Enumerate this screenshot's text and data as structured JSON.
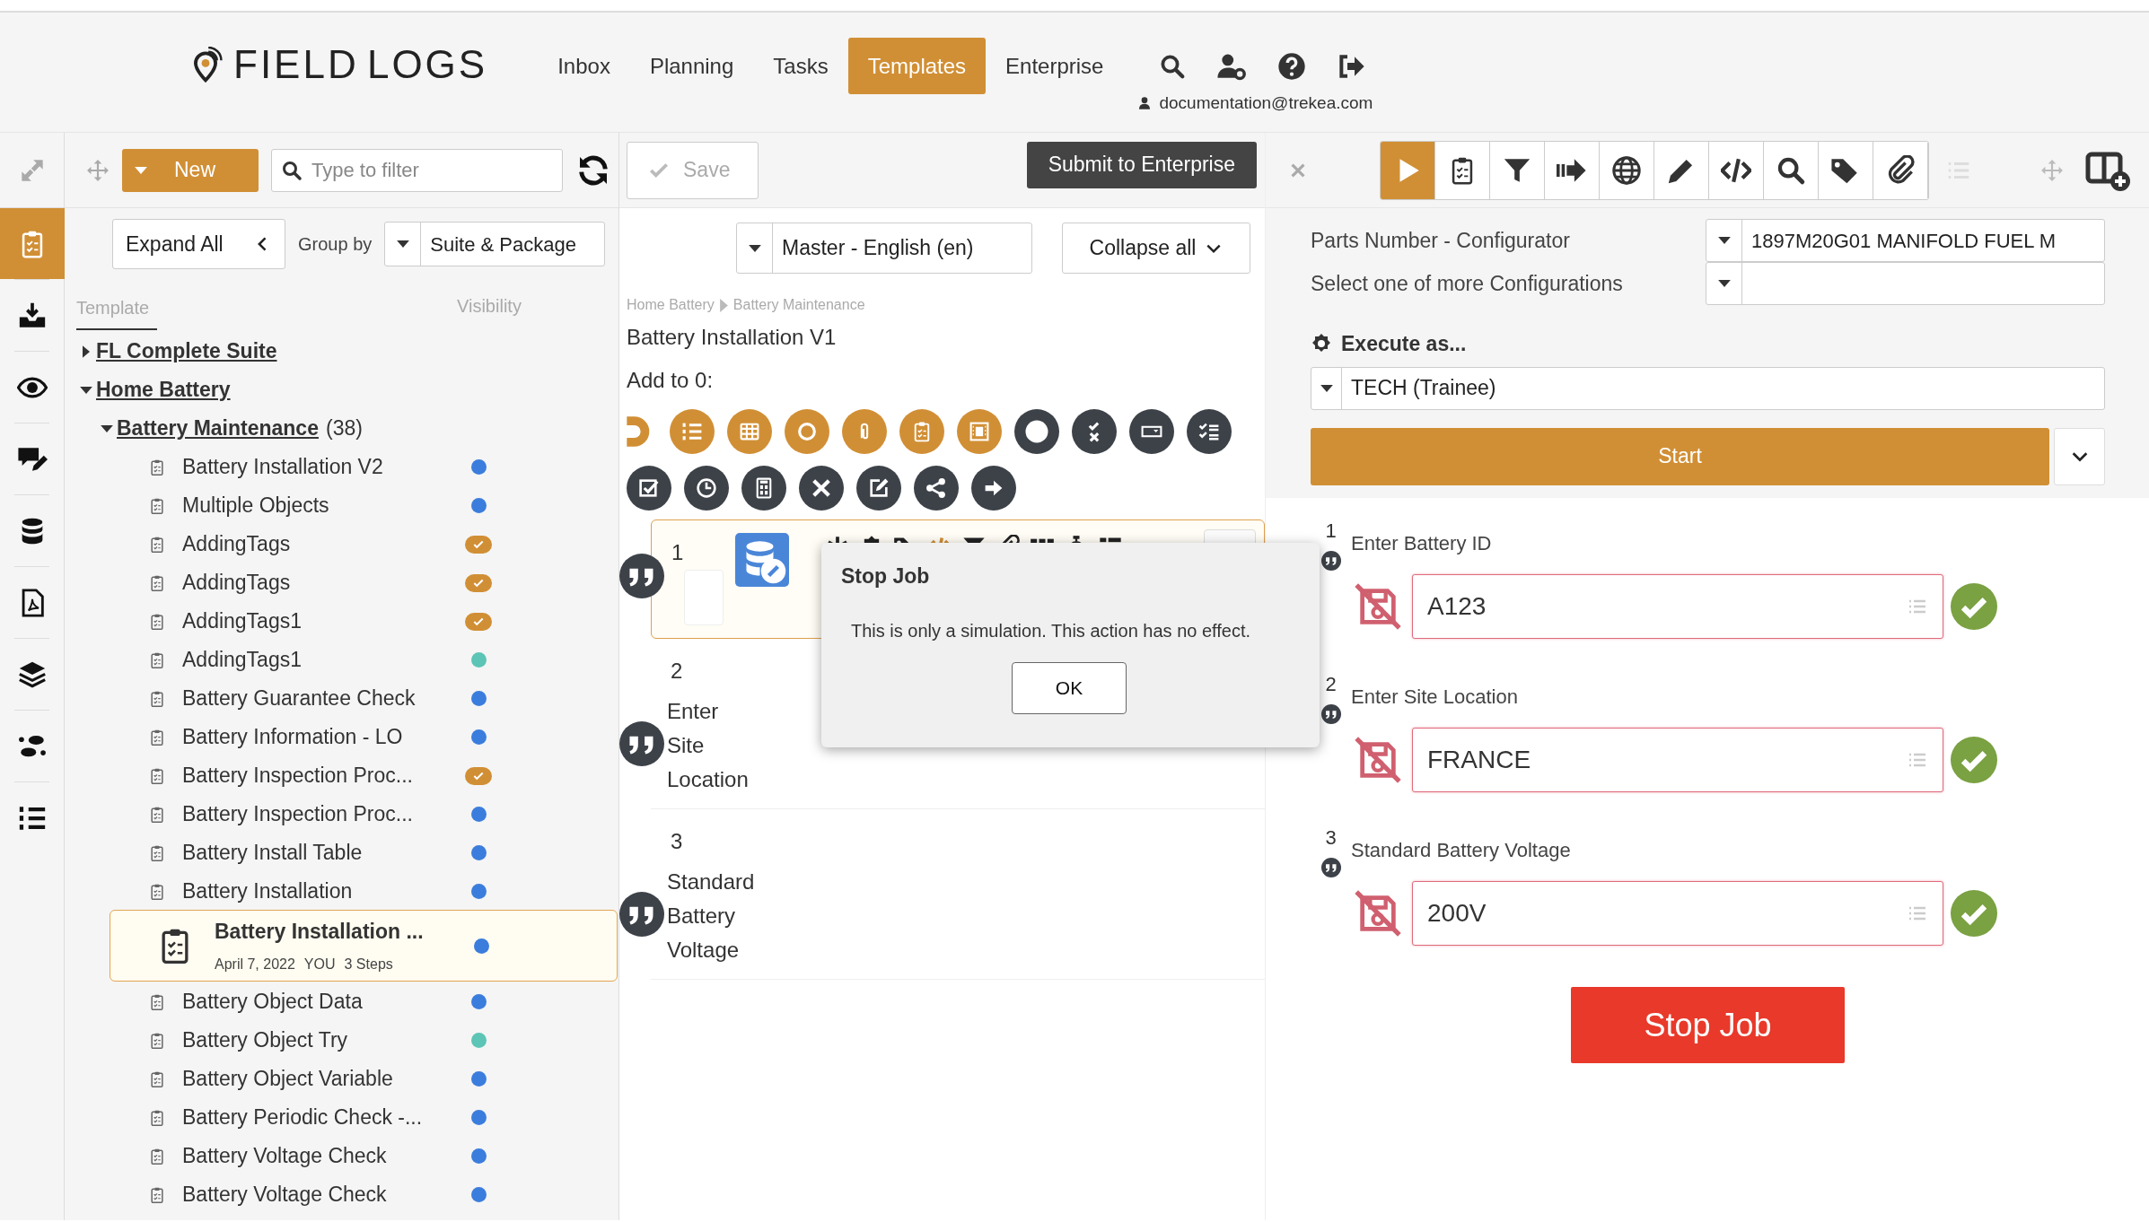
{
  "header": {
    "logo": "FIELD LOGS",
    "nav": [
      {
        "label": "Inbox",
        "selected": false
      },
      {
        "label": "Planning",
        "selected": false
      },
      {
        "label": "Tasks",
        "selected": false
      },
      {
        "label": "Templates",
        "selected": true
      },
      {
        "label": "Enterprise",
        "selected": false
      }
    ],
    "user_email": "documentation@trekea.com"
  },
  "rail": [
    {
      "selected": true
    },
    {
      "selected": false
    },
    {
      "selected": false
    },
    {
      "selected": false
    },
    {
      "selected": false
    },
    {
      "selected": false
    },
    {
      "selected": false
    },
    {
      "selected": false
    },
    {
      "selected": false
    }
  ],
  "left_panel": {
    "new_button": "New",
    "filter_placeholder": "Type to filter",
    "expand_button": "Expand All",
    "group_by_label": "Group by",
    "group_by_value": "Suite & Package",
    "columns": [
      "Template",
      "Visibility"
    ],
    "tree": [
      {
        "label": "FL Complete Suite",
        "expanded": false
      },
      {
        "label": "Home Battery",
        "expanded": true,
        "children": [
          {
            "label": "Battery Maintenance",
            "count": "(38)",
            "expanded": true,
            "children": [
              {
                "label": "Battery Installation V2",
                "kind": "dot",
                "color": "#3b7ddd",
                "selected": false
              },
              {
                "label": "Multiple Objects",
                "kind": "dot",
                "color": "#3b7ddd",
                "selected": false
              },
              {
                "label": "AddingTags",
                "kind": "check",
                "color": "#d18f35",
                "selected": false
              },
              {
                "label": "AddingTags",
                "kind": "check",
                "color": "#d18f35",
                "selected": false
              },
              {
                "label": "AddingTags1",
                "kind": "check",
                "color": "#d18f35",
                "selected": false
              },
              {
                "label": "AddingTags1",
                "kind": "dot",
                "color": "#5cc5b5",
                "selected": false
              },
              {
                "label": "Battery Guarantee Check",
                "kind": "dot",
                "color": "#3b7ddd",
                "selected": false
              },
              {
                "label": "Battery Information - LO",
                "kind": "dot",
                "color": "#3b7ddd",
                "selected": false
              },
              {
                "label": "Battery Inspection Proc...",
                "kind": "check",
                "color": "#d18f35",
                "selected": false
              },
              {
                "label": "Battery Inspection Proc...",
                "kind": "dot",
                "color": "#3b7ddd",
                "selected": false
              },
              {
                "label": "Battery Install Table",
                "kind": "dot",
                "color": "#3b7ddd",
                "selected": false
              },
              {
                "label": "Battery Installation",
                "kind": "dot",
                "color": "#3b7ddd",
                "selected": false
              },
              {
                "label": "Battery Installation ...",
                "kind": "dot",
                "color": "#3b7ddd",
                "selected": true,
                "date": "April 7, 2022",
                "author": "YOU",
                "steps": "3 Steps"
              },
              {
                "label": "Battery Object Data",
                "kind": "dot",
                "color": "#3b7ddd",
                "selected": false
              },
              {
                "label": "Battery Object Try",
                "kind": "dot",
                "color": "#5cc5b5",
                "selected": false
              },
              {
                "label": "Battery Object Variable",
                "kind": "dot",
                "color": "#3b7ddd",
                "selected": false
              },
              {
                "label": "Battery Periodic Check -...",
                "kind": "dot",
                "color": "#3b7ddd",
                "selected": false
              },
              {
                "label": "Battery Voltage Check",
                "kind": "dot",
                "color": "#3b7ddd",
                "selected": false
              },
              {
                "label": "Battery Voltage Check",
                "kind": "dot",
                "color": "#3b7ddd",
                "selected": false
              }
            ]
          }
        ]
      }
    ]
  },
  "middle": {
    "save_button": "Save",
    "submit_button": "Submit to Enterprise",
    "language": "Master - English (en)",
    "collapse_button": "Collapse all",
    "breadcrumb": [
      "Home Battery",
      "Battery Maintenance"
    ],
    "title": "Battery Installation V1",
    "add_label": "Add to 0:",
    "steps": [
      {
        "number": "1",
        "selected": true
      },
      {
        "number": "2",
        "label": "Enter Site Location",
        "selected": false
      },
      {
        "number": "3",
        "label": "Standard Battery Voltage",
        "selected": false
      }
    ]
  },
  "right_panel": {
    "tools": [
      {
        "selected": true
      },
      {
        "selected": false
      },
      {
        "selected": false
      },
      {
        "selected": false
      },
      {
        "selected": false
      },
      {
        "selected": false
      },
      {
        "selected": false
      },
      {
        "selected": false
      },
      {
        "selected": false
      },
      {
        "selected": false
      }
    ],
    "config": [
      {
        "label": "Parts Number - Configurator",
        "value": "1897M20G01 MANIFOLD FUEL M"
      },
      {
        "label": "Select one of more Configurations"
      }
    ],
    "execute_label": "Execute as...",
    "execute_value": "TECH (Trainee)",
    "start_button": "Start",
    "steps": [
      {
        "number": "1",
        "label": "Enter Battery ID",
        "value": "A123",
        "saved": false,
        "valid": true
      },
      {
        "number": "2",
        "label": "Enter Site Location",
        "value": "FRANCE",
        "saved": false,
        "valid": true
      },
      {
        "number": "3",
        "label": "Standard Battery Voltage",
        "value": "200V",
        "saved": false,
        "valid": true
      }
    ],
    "stop_button": "Stop Job"
  },
  "dialog": {
    "title": "Stop Job",
    "message": "This is only a simulation. This action has no effect.",
    "ok_button": "OK"
  }
}
